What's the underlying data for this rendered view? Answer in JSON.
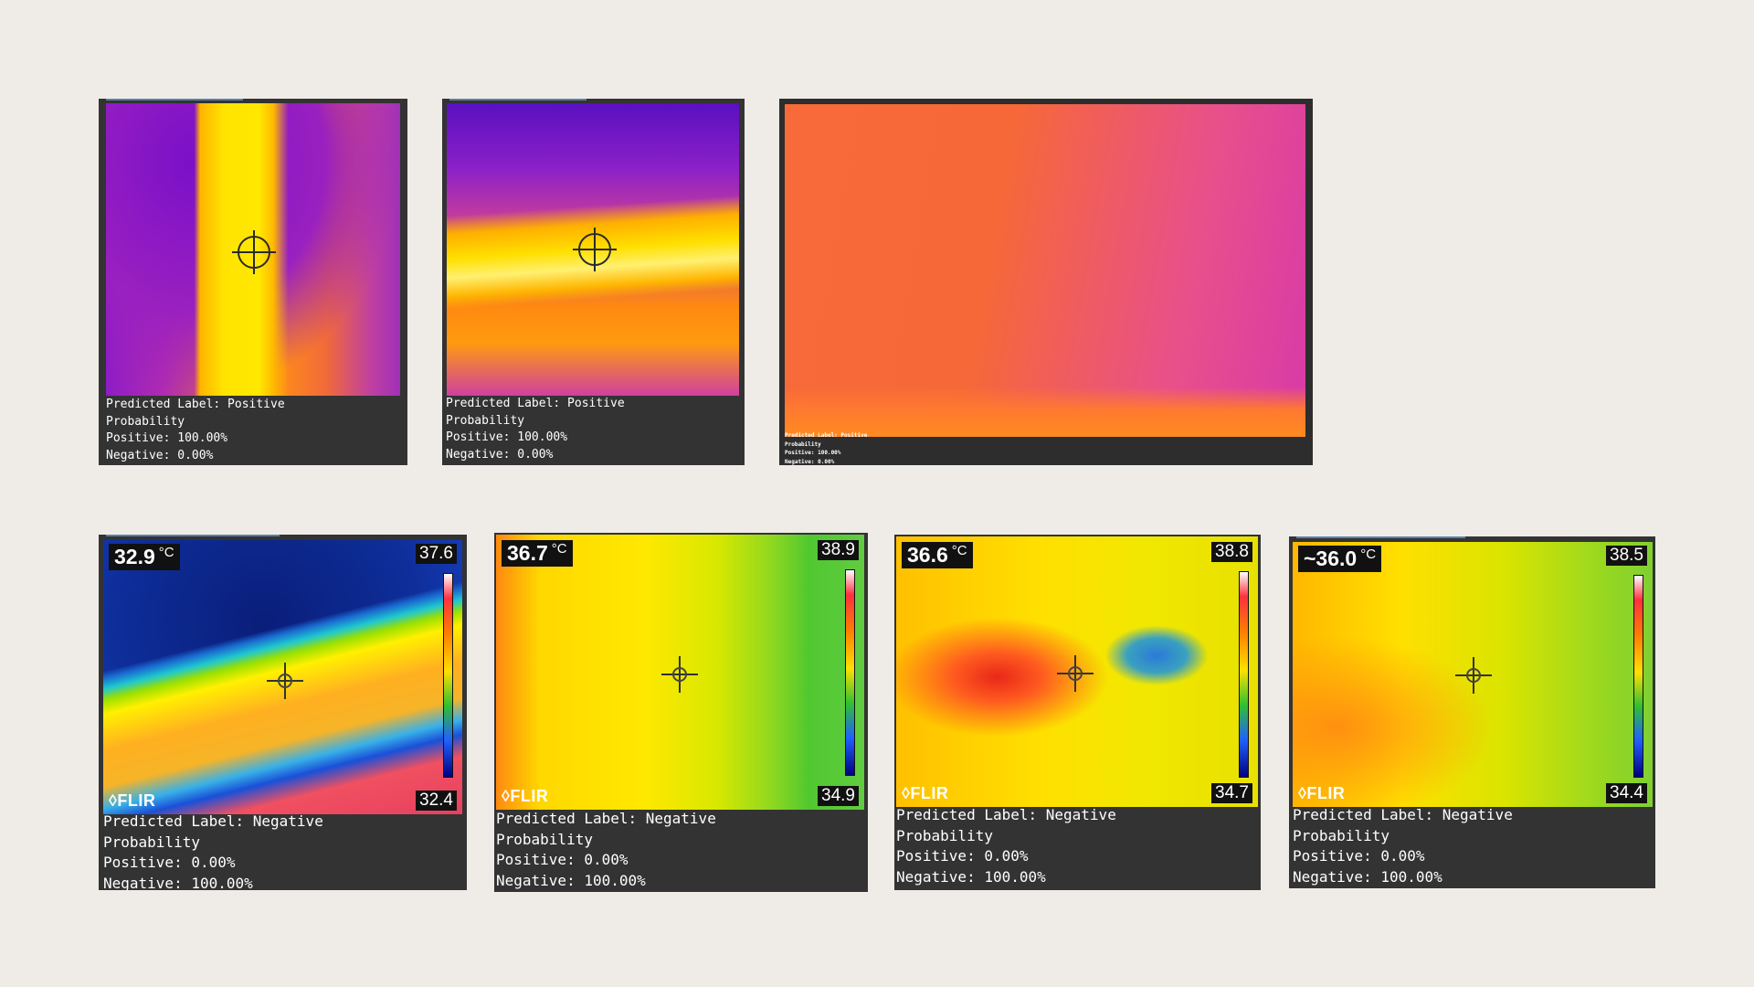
{
  "top_panels": [
    {
      "caption": [
        "Predicted Label: Positive",
        "Probability",
        "Positive: 100.00%",
        "Negative: 0.00%"
      ]
    },
    {
      "caption": [
        "Predicted Label: Positive",
        "Probability",
        "Positive: 100.00%",
        "Negative: 0.00%"
      ]
    },
    {
      "caption": [
        "Predicted Label: Positive",
        "Probability",
        "Positive: 100.00%",
        "Negative: 0.00%"
      ]
    }
  ],
  "bottom_panels": [
    {
      "spot_temp": "32.9",
      "unit": "°C",
      "scale_max": "37.6",
      "scale_min": "32.4",
      "brand": "FLIR",
      "caption": [
        "Predicted Label: Negative",
        "Probability",
        "Positive: 0.00%",
        "Negative: 100.00%"
      ]
    },
    {
      "spot_temp": "36.7",
      "unit": "°C",
      "scale_max": "38.9",
      "scale_min": "34.9",
      "brand": "FLIR",
      "caption": [
        "Predicted Label: Negative",
        "Probability",
        "Positive: 0.00%",
        "Negative: 100.00%"
      ]
    },
    {
      "spot_temp": "36.6",
      "unit": "°C",
      "scale_max": "38.8",
      "scale_min": "34.7",
      "brand": "FLIR",
      "caption": [
        "Predicted Label: Negative",
        "Probability",
        "Positive: 0.00%",
        "Negative: 100.00%"
      ]
    },
    {
      "spot_temp": "~36.0",
      "unit": "°C",
      "scale_max": "38.5",
      "scale_min": "34.4",
      "brand": "FLIR",
      "caption": [
        "Predicted Label: Negative",
        "Probability",
        "Positive: 0.00%",
        "Negative: 100.00%"
      ]
    }
  ],
  "colors": {
    "background": "#efece8",
    "panel": "#333333",
    "caption_text": "#ffffff"
  }
}
